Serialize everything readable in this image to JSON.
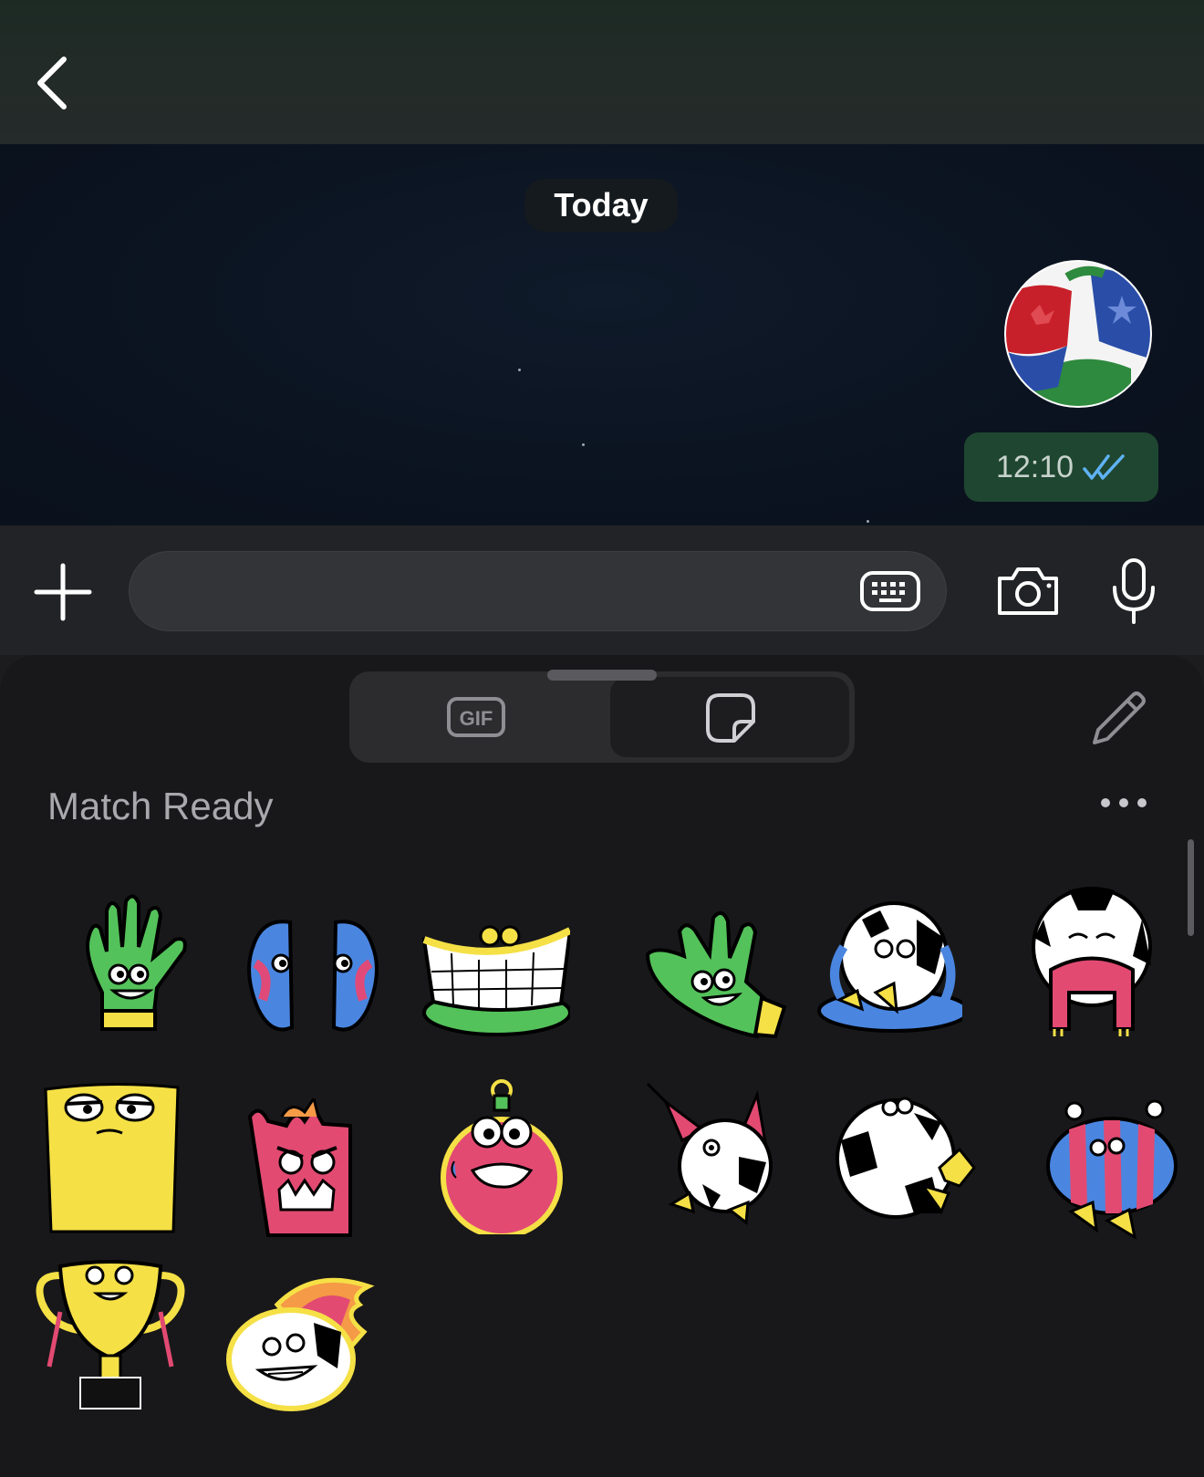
{
  "header": {
    "back_icon": "chevron-left-icon"
  },
  "chat": {
    "date_label": "Today",
    "message": {
      "type": "sticker",
      "sticker": "soccer-ball-sticker",
      "time": "12:10",
      "status": "read",
      "status_icon": "double-check-icon",
      "status_color": "#5fb3f5"
    }
  },
  "input_bar": {
    "plus_icon": "plus-icon",
    "text_value": "",
    "keyboard_icon": "keyboard-icon",
    "camera_icon": "camera-icon",
    "mic_icon": "microphone-icon"
  },
  "sheet": {
    "tabs": [
      {
        "id": "gif",
        "label": "GIF",
        "selected": false
      },
      {
        "id": "stickers",
        "icon": "sticker-icon",
        "selected": true
      }
    ],
    "edit_icon": "pencil-icon",
    "pack_title": "Match Ready",
    "more_icon": "more-icon",
    "stickers": [
      "goalkeeper-glove-sticker",
      "soccer-boots-sticker",
      "goal-net-sticker",
      "glove-sticker",
      "crying-ball-sticker",
      "shy-ball-sticker",
      "yellow-card-sticker",
      "red-card-sticker",
      "stopwatch-sticker",
      "party-ball-sticker",
      "rolling-ball-sticker",
      "striped-ball-sticker",
      "trophy-sticker",
      "fire-ball-sticker"
    ]
  },
  "colors": {
    "accent_green": "#1f4630",
    "read_blue": "#5fb3f5",
    "sheet_bg": "#18181a"
  }
}
